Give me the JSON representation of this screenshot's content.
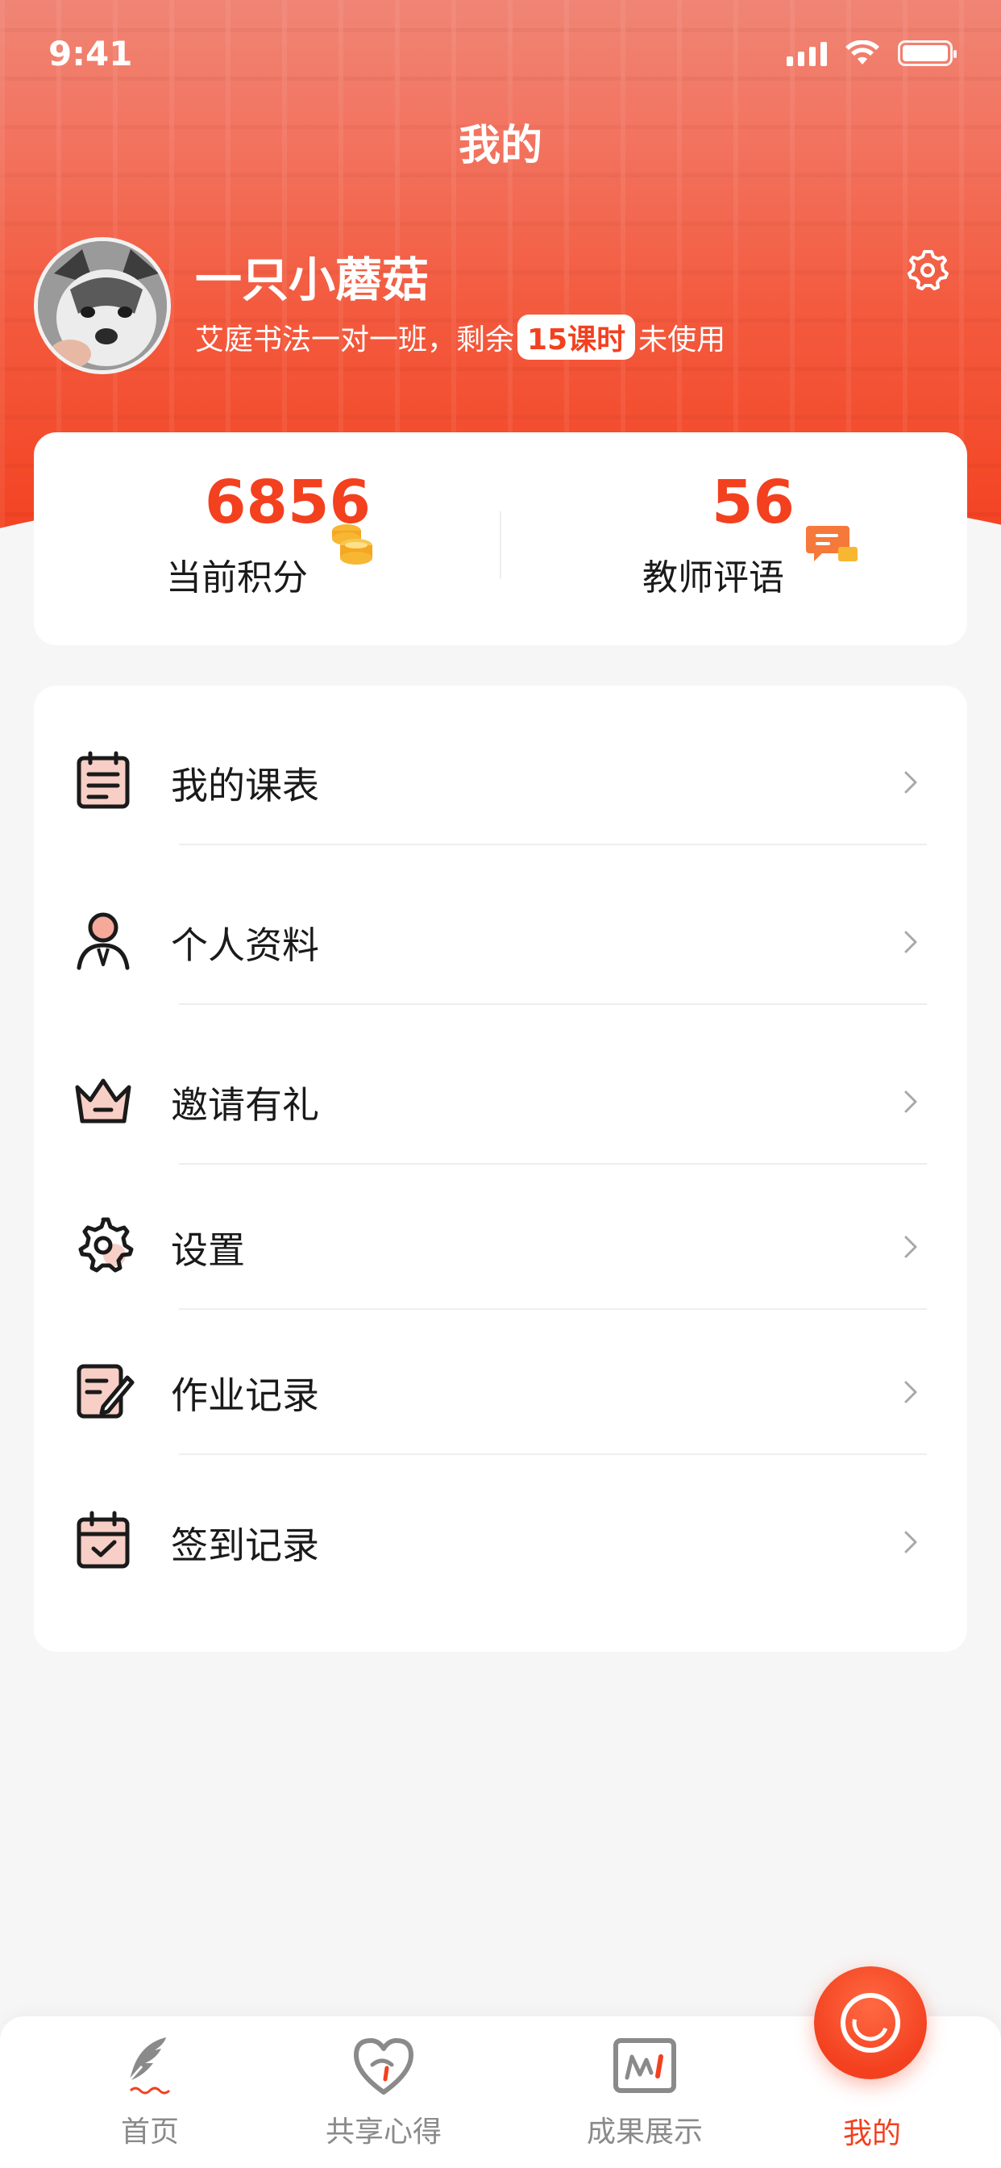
{
  "status_bar": {
    "time": "9:41"
  },
  "header": {
    "title": "我的"
  },
  "profile": {
    "name": "一只小蘑菇",
    "class_prefix": "艾庭书法一对一班，剩余",
    "remaining_badge": "15课时",
    "class_suffix": "未使用"
  },
  "stats": {
    "points": {
      "value": "6856",
      "label": "当前积分",
      "icon": "coins-icon"
    },
    "teacher_comments": {
      "value": "56",
      "label": "教师评语",
      "icon": "chat-icon"
    }
  },
  "menu": {
    "items": [
      {
        "label": "我的课表",
        "icon": "schedule-icon"
      },
      {
        "label": "个人资料",
        "icon": "profile-icon"
      },
      {
        "label": "邀请有礼",
        "icon": "crown-icon"
      },
      {
        "label": "设置",
        "icon": "gear-icon"
      },
      {
        "label": "作业记录",
        "icon": "homework-icon"
      },
      {
        "label": "签到记录",
        "icon": "checkin-calendar-icon"
      }
    ]
  },
  "tabbar": {
    "items": [
      {
        "label": "首页",
        "icon": "quill-icon",
        "active": false
      },
      {
        "label": "共享心得",
        "icon": "heart-icon",
        "active": false
      },
      {
        "label": "成果展示",
        "icon": "frame-icon",
        "active": false
      },
      {
        "label": "我的",
        "icon": "smile-icon",
        "active": true
      }
    ]
  },
  "colors": {
    "accent": "#f3401f",
    "header_gradient_top": "#f08575",
    "header_gradient_bottom": "#f3401f",
    "background": "#f6f6f6"
  }
}
